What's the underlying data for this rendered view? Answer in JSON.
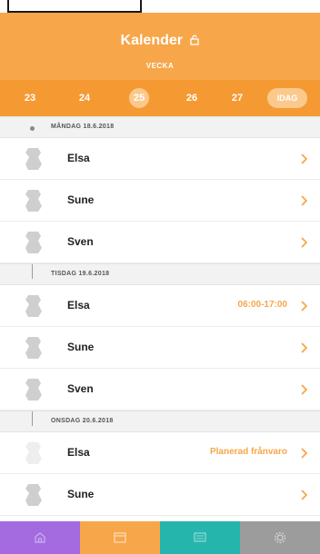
{
  "header": {
    "title": "Kalender",
    "view_label": "VECKA",
    "today_label": "IDAG"
  },
  "days": [
    {
      "label": "23",
      "selected": false
    },
    {
      "label": "24",
      "selected": false
    },
    {
      "label": "25",
      "selected": true
    },
    {
      "label": "26",
      "selected": false
    },
    {
      "label": "27",
      "selected": false
    }
  ],
  "sections": [
    {
      "label": "MÅNDAG 18.6.2018",
      "rows": [
        {
          "name": "Elsa",
          "status": ""
        },
        {
          "name": "Sune",
          "status": ""
        },
        {
          "name": "Sven",
          "status": ""
        }
      ]
    },
    {
      "label": "TISDAG 19.6.2018",
      "rows": [
        {
          "name": "Elsa",
          "status": "06:00-17:00"
        },
        {
          "name": "Sune",
          "status": ""
        },
        {
          "name": "Sven",
          "status": ""
        }
      ]
    },
    {
      "label": "ONSDAG 20.6.2018",
      "rows": [
        {
          "name": "Elsa",
          "status": "Planerad frånvaro"
        },
        {
          "name": "Sune",
          "status": ""
        }
      ]
    }
  ],
  "tabs": [
    {
      "name": "home",
      "icon": "home-icon",
      "color": "#a46be0"
    },
    {
      "name": "calendar",
      "icon": "calendar-icon",
      "color": "#f7a64a"
    },
    {
      "name": "messages",
      "icon": "message-icon",
      "color": "#26b5ac"
    },
    {
      "name": "settings",
      "icon": "gear-icon",
      "color": "#9c9c9c"
    }
  ],
  "colors": {
    "accent": "#f7a64a",
    "accent_dark": "#f59a33",
    "text": "#222222"
  }
}
